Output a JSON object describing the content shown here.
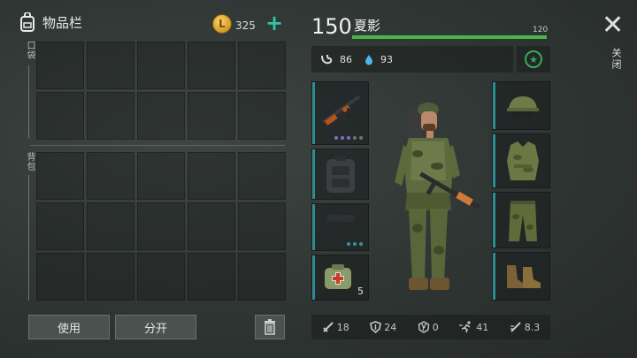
{
  "inventory": {
    "title": "物品栏",
    "icon": "backpack-icon",
    "coins": "325",
    "add_symbol": "+",
    "pockets_label": "口袋",
    "backpack_label": "背包",
    "use_button": "使用",
    "split_button": "分开",
    "trash_icon": "trash-icon"
  },
  "character": {
    "level": "150",
    "name": "夏影",
    "hp_value": "120",
    "hp_fraction": 0.98,
    "hunger": "86",
    "thirst": "93",
    "hp_color": "#49b64a"
  },
  "equipment": {
    "left_slots": [
      {
        "item": "rifle-icon",
        "accent": "#2e8d92",
        "dots": [
          "#8a6bc9",
          "#8a6bc9",
          "#8a6bc9",
          "#6f7773",
          "#6f7773"
        ]
      },
      {
        "item": "backpack-icon",
        "accent": "#2e8d92",
        "dots": []
      },
      {
        "item": "pistol-icon",
        "accent": "#2e8d92",
        "dots": [
          "#3a8fa0",
          "#3a8fa0",
          "#3a8fa0"
        ]
      },
      {
        "item": "medkit-icon",
        "accent": "#2e8d92",
        "count": "5"
      }
    ],
    "right_slots": [
      {
        "item": "helmet-icon",
        "accent": "#2e8d92"
      },
      {
        "item": "vest-icon",
        "accent": "#2e8d92"
      },
      {
        "item": "pants-icon",
        "accent": "#2e8d92"
      },
      {
        "item": "boots-icon",
        "accent": "#2e8d92"
      }
    ]
  },
  "close": {
    "label": "关闭"
  },
  "bottom_stats": {
    "attack": "18",
    "defense": "24",
    "radiation": "0",
    "speed": "41",
    "damage_rate": "8.3"
  }
}
